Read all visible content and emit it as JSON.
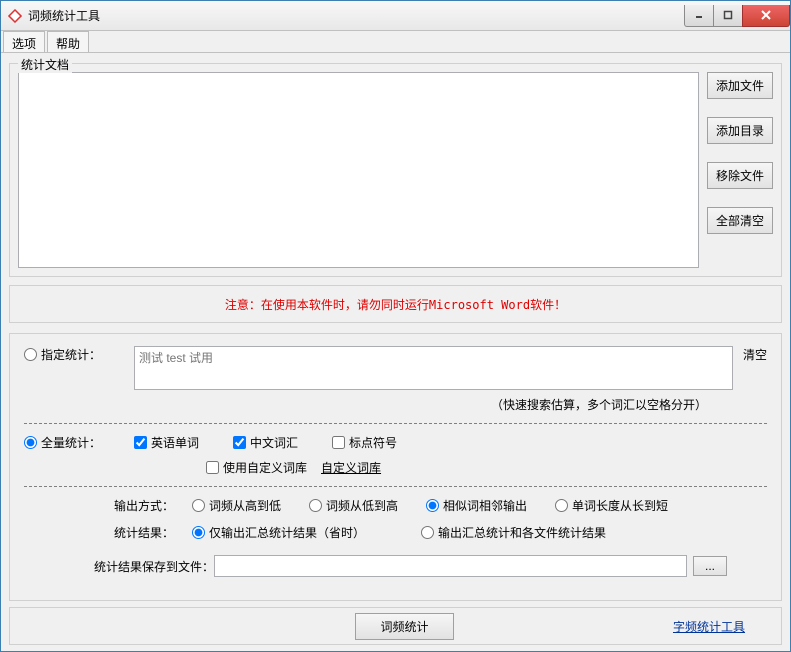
{
  "window": {
    "title": "词频统计工具"
  },
  "menu": {
    "options": "选项",
    "help": "帮助"
  },
  "docs": {
    "legend": "统计文档",
    "add_file": "添加文件",
    "add_dir": "添加目录",
    "remove_file": "移除文件",
    "clear_all": "全部清空"
  },
  "notice": "注意：在使用本软件时，请勿同时运行Microsoft Word软件！",
  "spec": {
    "radio_label": "指定统计：",
    "placeholder": "测试 test 试用",
    "clear": "清空",
    "hint": "（快速搜索估算，多个词汇以空格分开）"
  },
  "full": {
    "radio_label": "全量统计：",
    "english": "英语单词",
    "chinese": "中文词汇",
    "punct": "标点符号",
    "custom_dict": "使用自定义词库",
    "custom_link": "自定义词库"
  },
  "output": {
    "label": "输出方式：",
    "high_low": "词频从高到低",
    "low_high": "词频从低到高",
    "similar": "相似词相邻输出",
    "length": "单词长度从长到短"
  },
  "result": {
    "label": "统计结果：",
    "summary_only": "仅输出汇总统计结果（省时）",
    "summary_each": "输出汇总统计和各文件统计结果"
  },
  "savefile": {
    "label": "统计结果保存到文件：",
    "browse": "..."
  },
  "footer": {
    "run": "词频统计",
    "char_tool": "字频统计工具"
  }
}
